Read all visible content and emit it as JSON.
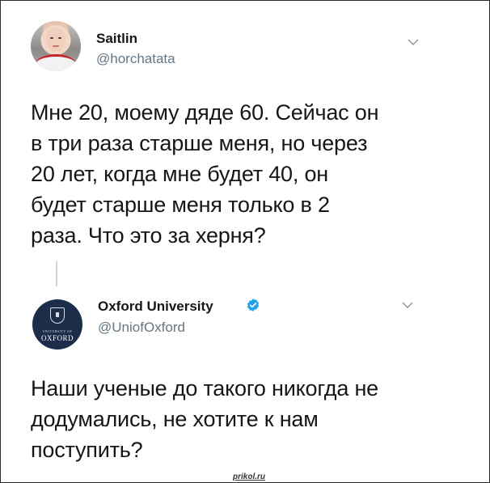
{
  "tweets": [
    {
      "author": {
        "display_name": "Saitlin",
        "handle": "@horchatata",
        "avatar_icon": "user-photo-avatar",
        "verified": false
      },
      "text": "Мне 20, моему дяде 60. Сейчас он\nв три раза старше меня, но через\n20 лет, когда мне будет 40, он\nбудет старше меня только в 2\nраза. Что это за херня?",
      "menu_icon": "chevron-down-icon"
    },
    {
      "author": {
        "display_name": "Oxford University",
        "handle": "@UniofOxford",
        "avatar_icon": "oxford-crest-logo",
        "avatar_text_small": "UNIVERSITY OF",
        "avatar_text_main": "OXFORD",
        "verified": true,
        "verified_icon": "verified-badge-icon"
      },
      "text": "Наши ученые до такого никогда не\nдодумались, не хотите к нам\nпоступить?",
      "menu_icon": "chevron-down-icon"
    }
  ],
  "watermark": "prikol.ru",
  "colors": {
    "text_primary": "#14171a",
    "text_secondary": "#657786",
    "verified_blue": "#1da1f2",
    "thread_line": "#ccd6dd",
    "border": "#2b2b2b"
  }
}
